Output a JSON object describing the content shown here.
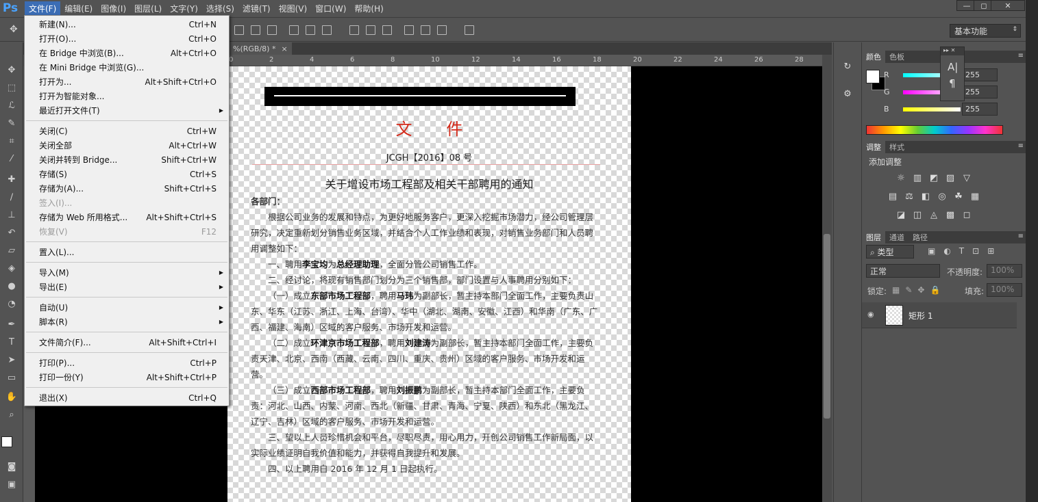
{
  "app": {
    "logo": "Ps"
  },
  "menubar": {
    "items": [
      "文件(F)",
      "编辑(E)",
      "图像(I)",
      "图层(L)",
      "文字(Y)",
      "选择(S)",
      "滤镜(T)",
      "视图(V)",
      "窗口(W)",
      "帮助(H)"
    ],
    "active_index": 0
  },
  "window_controls": {
    "minimize": "—",
    "restore": "◻",
    "close": "✕"
  },
  "options_bar": {
    "workspace": "基本功能"
  },
  "document_tab": {
    "label": "%(RGB/8) *",
    "close": "×"
  },
  "ruler": {
    "marks": [
      "0",
      "2",
      "4",
      "6",
      "8",
      "10",
      "12",
      "14",
      "16",
      "18",
      "20",
      "22",
      "24",
      "26",
      "28"
    ]
  },
  "file_menu": {
    "items": [
      {
        "label": "新建(N)...",
        "shortcut": "Ctrl+N"
      },
      {
        "label": "打开(O)...",
        "shortcut": "Ctrl+O"
      },
      {
        "label": "在 Bridge 中浏览(B)...",
        "shortcut": "Alt+Ctrl+O"
      },
      {
        "label": "在 Mini Bridge 中浏览(G)...",
        "shortcut": ""
      },
      {
        "label": "打开为...",
        "shortcut": "Alt+Shift+Ctrl+O"
      },
      {
        "label": "打开为智能对象...",
        "shortcut": ""
      },
      {
        "label": "最近打开文件(T)",
        "shortcut": "",
        "submenu": true
      },
      {
        "sep": true
      },
      {
        "label": "关闭(C)",
        "shortcut": "Ctrl+W"
      },
      {
        "label": "关闭全部",
        "shortcut": "Alt+Ctrl+W"
      },
      {
        "label": "关闭并转到 Bridge...",
        "shortcut": "Shift+Ctrl+W"
      },
      {
        "label": "存储(S)",
        "shortcut": "Ctrl+S"
      },
      {
        "label": "存储为(A)...",
        "shortcut": "Shift+Ctrl+S"
      },
      {
        "label": "签入(I)...",
        "shortcut": "",
        "disabled": true
      },
      {
        "label": "存储为 Web 所用格式...",
        "shortcut": "Alt+Shift+Ctrl+S"
      },
      {
        "label": "恢复(V)",
        "shortcut": "F12",
        "disabled": true
      },
      {
        "sep": true
      },
      {
        "label": "置入(L)...",
        "shortcut": ""
      },
      {
        "sep": true
      },
      {
        "label": "导入(M)",
        "shortcut": "",
        "submenu": true
      },
      {
        "label": "导出(E)",
        "shortcut": "",
        "submenu": true
      },
      {
        "sep": true
      },
      {
        "label": "自动(U)",
        "shortcut": "",
        "submenu": true
      },
      {
        "label": "脚本(R)",
        "shortcut": "",
        "submenu": true
      },
      {
        "sep": true
      },
      {
        "label": "文件简介(F)...",
        "shortcut": "Alt+Shift+Ctrl+I"
      },
      {
        "sep": true
      },
      {
        "label": "打印(P)...",
        "shortcut": "Ctrl+P"
      },
      {
        "label": "打印一份(Y)",
        "shortcut": "Alt+Shift+Ctrl+P"
      },
      {
        "sep": true
      },
      {
        "label": "退出(X)",
        "shortcut": "Ctrl+Q"
      }
    ]
  },
  "document": {
    "header": "文件",
    "number": "JCGH【2016】08 号",
    "title": "关于增设市场工程部及相关干部聘用的通知",
    "salutation": "各部门：",
    "paragraphs": [
      [
        {
          "t": "根据公司业务的发展和特点，为更好地服务客户，更深入挖掘市场潜力，经公司管理层研究，决定重新划分销售业务区域，并结合个人工作业绩和表现，对销售业务部门和人员聘用调整如下："
        }
      ],
      [
        {
          "t": "一、聘用"
        },
        {
          "t": "李宝均",
          "b": true
        },
        {
          "t": "为"
        },
        {
          "t": "总经理助理",
          "b": true
        },
        {
          "t": "，全面分管公司销售工作。"
        }
      ],
      [
        {
          "t": "二、经讨论，将现有销售部门划分为三个销售部，部门设置与人事聘用分别如下："
        }
      ],
      [
        {
          "t": "（一）成立"
        },
        {
          "t": "东部市场工程部",
          "b": true
        },
        {
          "t": "，聘用"
        },
        {
          "t": "马玮",
          "b": true
        },
        {
          "t": "为副部长，暂主持本部门全面工作，主要负责山东、华东（江苏、浙江、上海、台湾）、华中（湖北、湖南、安徽、江西）和华南（广东、广西、福建、海南）区域的客户服务、市场开发和运营。"
        }
      ],
      [
        {
          "t": "（二）成立"
        },
        {
          "t": "环津京市场工程部",
          "b": true
        },
        {
          "t": "，聘用"
        },
        {
          "t": "刘建涛",
          "b": true
        },
        {
          "t": "为副部长，暂主持本部门全面工作，主要负责天津、北京、西南（西藏、云南、四川、重庆、贵州）区域的客户服务、市场开发和运营。"
        }
      ],
      [
        {
          "t": "（三）成立"
        },
        {
          "t": "西部市场工程部",
          "b": true
        },
        {
          "t": "，聘用"
        },
        {
          "t": "刘振鹏",
          "b": true
        },
        {
          "t": "为副部长，暂主持本部门全面工作，主要负责：河北、山西、内蒙、河南、西北（新疆、甘肃、青海、宁夏、陕西）和东北（黑龙江、辽宁、吉林）区域的客户服务、市场开发和运营。"
        }
      ],
      [
        {
          "t": "三、望以上人员珍惜机会和平台，尽职尽责，用心用力，开创公司销售工作新局面，以实际业绩证明自我价值和能力，并获得自我提升和发展。"
        }
      ],
      [
        {
          "t": "四、以上聘用自 2016 年 12 月 1 日起执行。"
        }
      ]
    ]
  },
  "color_panel": {
    "tabs": [
      "颜色",
      "色板"
    ],
    "channels": [
      {
        "label": "R",
        "value": "255"
      },
      {
        "label": "G",
        "value": "255"
      },
      {
        "label": "B",
        "value": "255"
      }
    ]
  },
  "adjust_panel": {
    "tabs": [
      "调整",
      "样式"
    ],
    "heading": "添加调整"
  },
  "layers_panel": {
    "tabs": [
      "图层",
      "通道",
      "路径"
    ],
    "filter": "类型",
    "blend_mode": "正常",
    "opacity_label": "不透明度:",
    "opacity": "100%",
    "lock_label": "锁定:",
    "fill_label": "填充:",
    "fill": "100%",
    "layers": [
      {
        "name": "矩形 1"
      }
    ]
  },
  "colors": {
    "accent": "#3b6db5",
    "header_red": "#d42a1a"
  }
}
